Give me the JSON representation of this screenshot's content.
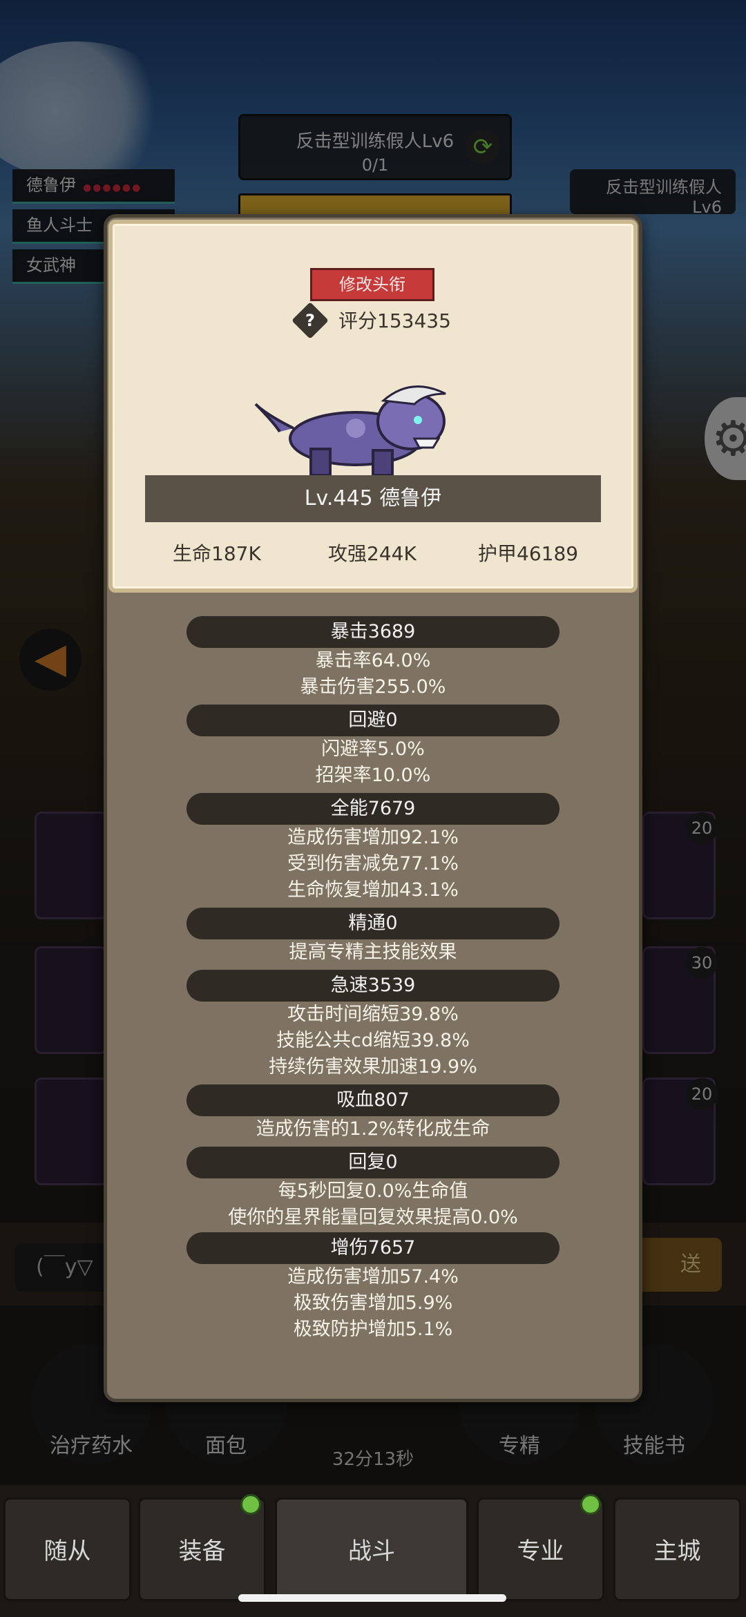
{
  "hud": {
    "enemy_name": "反击型训练假人Lv6",
    "enemy_count": "0/1",
    "swap_icon": "swap-icon",
    "target_line1": "反击型训练假人",
    "target_line2": "Lv6"
  },
  "party": [
    {
      "name": "德鲁伊"
    },
    {
      "name": "鱼人斗士"
    },
    {
      "name": "女武神"
    }
  ],
  "side_badges": [
    "20",
    "30",
    "20"
  ],
  "chat": {
    "input_text": "(￣y▽",
    "send_label": "送"
  },
  "quick": {
    "items": [
      "治疗药水",
      "面包",
      "专精",
      "技能书"
    ],
    "timer": "32分13秒"
  },
  "tabs": [
    "随从",
    "装备",
    "战斗",
    "专业",
    "主城"
  ],
  "card": {
    "rename_label": "修改头衔",
    "score": "评分153435",
    "level_name": "Lv.445 德鲁伊",
    "hp": "生命187K",
    "attack": "攻强244K",
    "armor": "护甲46189"
  },
  "stats": {
    "crit": {
      "header": "暴击3689",
      "lines": [
        "暴击率64.0%",
        "暴击伤害255.0%"
      ]
    },
    "dodge": {
      "header": "回避0",
      "lines": [
        "闪避率5.0%",
        "招架率10.0%"
      ]
    },
    "versatility": {
      "header": "全能7679",
      "lines": [
        "造成伤害增加92.1%",
        "受到伤害减免77.1%",
        "生命恢复增加43.1%"
      ]
    },
    "mastery": {
      "header": "精通0",
      "lines": [
        "提高专精主技能效果"
      ]
    },
    "haste": {
      "header": "急速3539",
      "lines": [
        "攻击时间缩短39.8%",
        "技能公共cd缩短39.8%",
        "持续伤害效果加速19.9%"
      ]
    },
    "leech": {
      "header": "吸血807",
      "lines": [
        "造成伤害的1.2%转化成生命"
      ]
    },
    "regen": {
      "header": "回复0",
      "lines": [
        "每5秒回复0.0%生命值",
        "使你的星界能量回复效果提高0.0%"
      ]
    },
    "damage": {
      "header": "增伤7657",
      "lines": [
        "造成伤害增加57.4%",
        "极致伤害增加5.9%",
        "极致防护增加5.1%"
      ]
    }
  }
}
